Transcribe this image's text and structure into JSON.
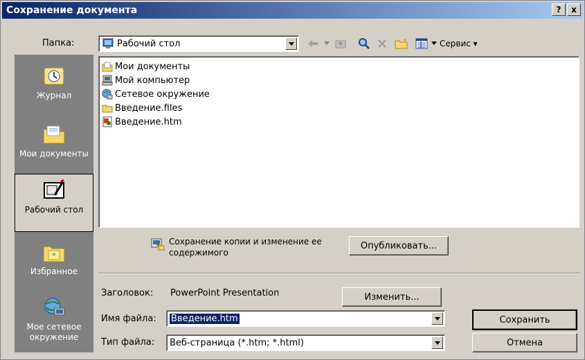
{
  "window": {
    "title": "Сохранение документа",
    "help_label": "?",
    "close_label": "x"
  },
  "toolbar": {
    "folder_label": "Папка:",
    "folder_value": "Рабочий стол",
    "service_label": "Сервис ▾"
  },
  "places": [
    {
      "label": "Журнал",
      "icon": "history-icon"
    },
    {
      "label": "Мои документы",
      "icon": "my-documents-icon"
    },
    {
      "label": "Рабочий стол",
      "icon": "desktop-icon",
      "selected": true
    },
    {
      "label": "Избранное",
      "icon": "favorites-icon"
    },
    {
      "label": "Мое сетевое окружение",
      "icon": "network-icon"
    }
  ],
  "files": [
    {
      "name": "Мои документы",
      "icon": "my-documents-icon"
    },
    {
      "name": "Мой компьютер",
      "icon": "my-computer-icon"
    },
    {
      "name": "Сетевое окружение",
      "icon": "network-icon"
    },
    {
      "name": "Введение.files",
      "icon": "folder-icon"
    },
    {
      "name": "Введение.htm",
      "icon": "html-file-icon"
    }
  ],
  "publish": {
    "text": "Сохранение копии и изменение ее содержимого",
    "button_label": "Опубликовать..."
  },
  "title_field": {
    "label": "Заголовок:",
    "value": "PowerPoint Presentation",
    "change_label": "Изменить..."
  },
  "filename": {
    "label": "Имя файла:",
    "value": "Введение.htm"
  },
  "filetype": {
    "label": "Тип файла:",
    "value": "Веб-страница (*.htm; *.html)"
  },
  "actions": {
    "save_label": "Сохранить",
    "cancel_label": "Отмена"
  }
}
